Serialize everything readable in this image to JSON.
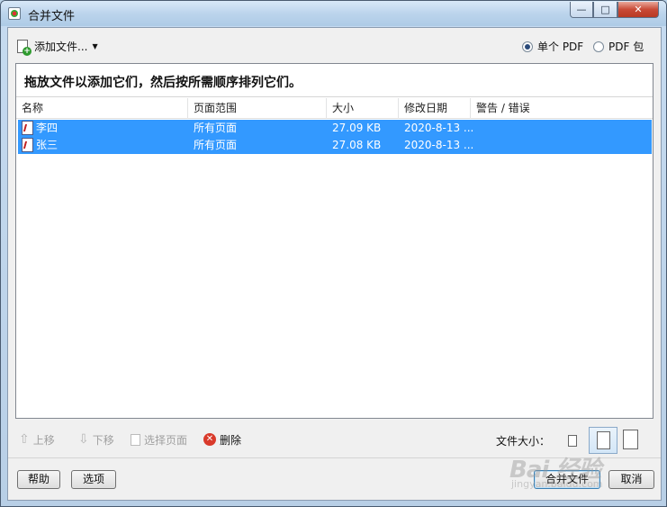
{
  "window": {
    "title": "合并文件",
    "controls": {
      "minimize": "—",
      "maximize": "□",
      "close": "✕"
    }
  },
  "toolbar": {
    "add_files_label": "添加文件...",
    "options": [
      {
        "label": "单个 PDF",
        "checked": true
      },
      {
        "label": "PDF 包",
        "checked": false
      }
    ]
  },
  "instruction": "拖放文件以添加它们，然后按所需顺序排列它们。",
  "table": {
    "columns": [
      "名称",
      "页面范围",
      "大小",
      "修改日期",
      "警告 / 错误"
    ],
    "rows": [
      {
        "name": "李四",
        "range": "所有页面",
        "size": "27.09 KB",
        "date": "2020-8-13 ...",
        "warning": "",
        "selected": true
      },
      {
        "name": "张三",
        "range": "所有页面",
        "size": "27.08 KB",
        "date": "2020-8-13 ...",
        "warning": "",
        "selected": true
      }
    ]
  },
  "bottom_tools": {
    "move_up": "上移",
    "move_down": "下移",
    "choose_pages": "选择页面",
    "delete": "删除",
    "file_size_label": "文件大小："
  },
  "buttons": {
    "help": "帮助",
    "options": "选项",
    "merge": "合并文件",
    "cancel": "取消"
  },
  "watermark": {
    "main": "Bai 经验",
    "sub": "jingyan.baidu.com"
  },
  "colors": {
    "selection": "#3399ff",
    "title_gradient_top": "#d8e8f7",
    "close_button": "#c94a36"
  }
}
